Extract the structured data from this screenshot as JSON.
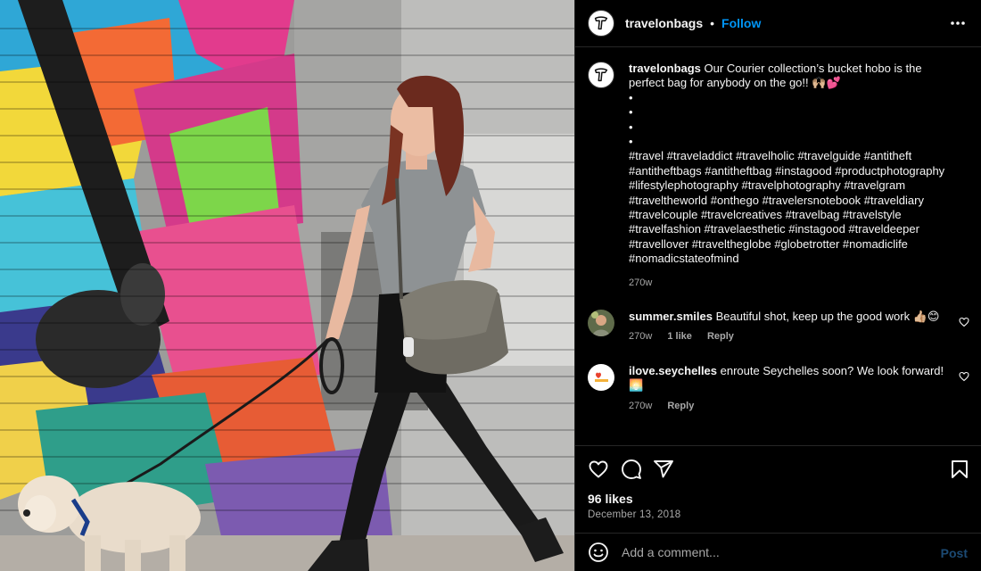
{
  "post": {
    "username": "travelonbags",
    "follow_label": "Follow",
    "dot": "•",
    "image_alt": "Woman walking a small white dog past a colorful mural, carrying a gray crossbody bucket hobo bag"
  },
  "caption": {
    "username": "travelonbags",
    "text": "Our Courier collection’s bucket hobo is the perfect bag for anybody on the go!! 🙌🏼💕",
    "bullets": [
      "•",
      "•",
      "•",
      "•"
    ],
    "hashtags": "#travel #traveladdict #travelholic #travelguide #antitheft #antitheftbags #antitheftbag #instagood #productphotography #lifestylephotography #travelphotography #travelgram #traveltheworld #onthego #travelersnotebook #traveldiary #travelcouple #travelcreatives #travelbag #travelstyle #travelfashion #travelaesthetic #instagood #traveldeeper #travellover #traveltheglobe #globetrotter #nomadiclife #nomadicstateofmind",
    "time": "270w"
  },
  "comments": [
    {
      "username": "summer.smiles",
      "text": "Beautiful shot, keep up the good work 👍🏼😊",
      "time": "270w",
      "likes": "1 like",
      "reply": "Reply"
    },
    {
      "username": "ilove.seychelles",
      "text": "enroute Seychelles soon? We look forward! 🌅",
      "time": "270w",
      "reply": "Reply"
    }
  ],
  "stats": {
    "likes": "96 likes",
    "date": "December 13, 2018"
  },
  "composer": {
    "placeholder": "Add a comment...",
    "post_label": "Post"
  },
  "icons": {
    "more": "more-horizontal-icon",
    "like": "heart-icon",
    "comment": "comment-bubble-icon",
    "share": "paper-plane-icon",
    "save": "bookmark-icon",
    "emoji": "smiley-icon"
  },
  "colors": {
    "background": "#000000",
    "text": "#f5f5f5",
    "muted": "#a8a8a8",
    "link_blue": "#0095f6",
    "divider": "#262626"
  }
}
